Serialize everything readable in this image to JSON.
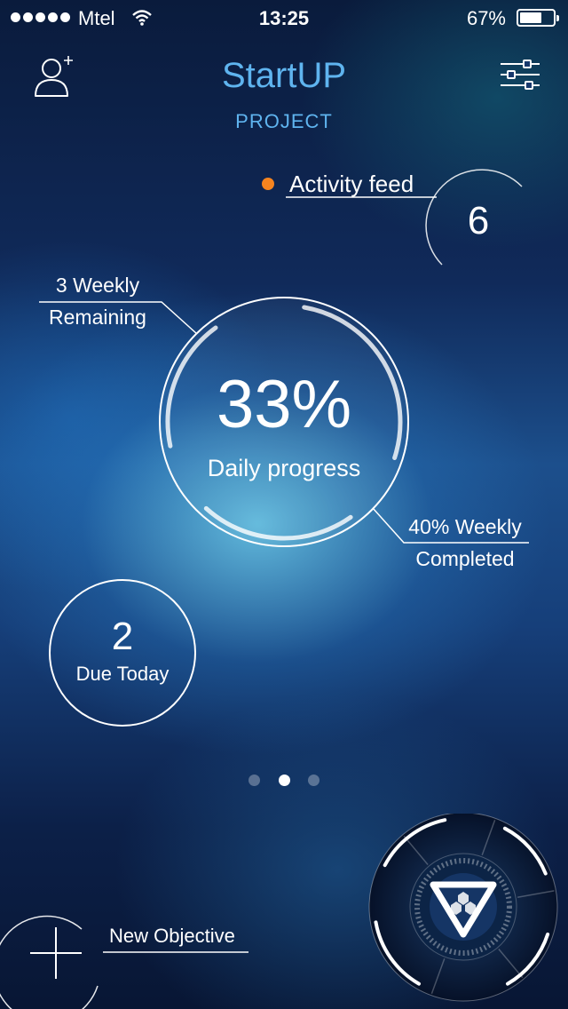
{
  "status_bar": {
    "carrier": "Mtel",
    "time": "13:25",
    "battery_percent": "67%",
    "battery_level": 0.67
  },
  "header": {
    "title": "StartUP",
    "subtitle": "PROJECT",
    "left_icon": "add-user-icon",
    "right_icon": "settings-sliders-icon"
  },
  "activity": {
    "label": "Activity feed",
    "count": "6",
    "dot_color": "#f5841f"
  },
  "progress": {
    "percent_label": "33%",
    "caption": "Daily progress",
    "daily_value": 0.33,
    "weekly_remaining_line1": "3 Weekly",
    "weekly_remaining_line2": "Remaining",
    "weekly_completed_line1": "40% Weekly",
    "weekly_completed_line2": "Completed"
  },
  "due": {
    "count": "2",
    "label": "Due Today"
  },
  "pager": {
    "pages": 3,
    "active": 2
  },
  "actions": {
    "new_objective": "New Objective",
    "plus_icon": "plus-icon",
    "main_icon": "hexagon-logo-icon"
  },
  "colors": {
    "accent": "#5fb4ef",
    "notification": "#f5841f"
  }
}
